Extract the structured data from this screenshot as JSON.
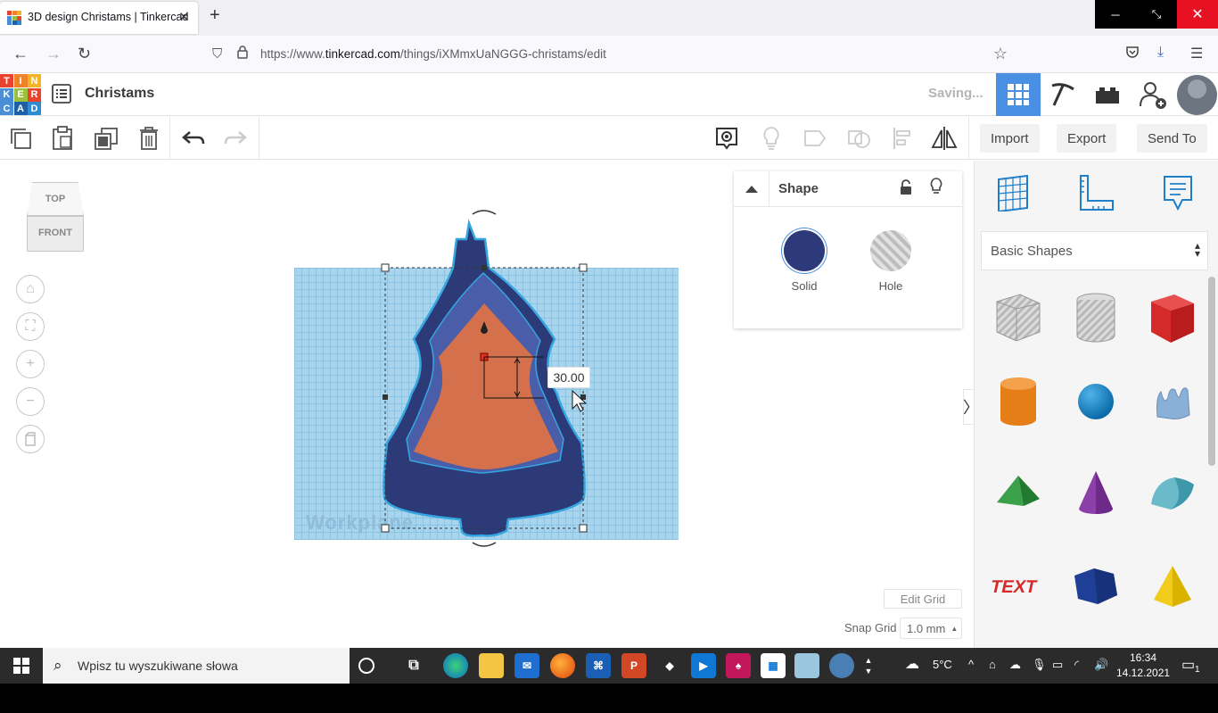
{
  "browser": {
    "tab_title": "3D design Christams | Tinkercad",
    "tab_close": "✕",
    "new_tab": "+",
    "url_prefix": "https://www.",
    "url_domain": "tinkercad.com",
    "url_path": "/things/iXMmxUaNGGG-christams/edit",
    "window_controls": {
      "minimize": "─",
      "maximize": "⤡",
      "close": "✕"
    }
  },
  "app": {
    "logo_letters": [
      "T",
      "I",
      "N",
      "K",
      "E",
      "R",
      "C",
      "A",
      "D"
    ],
    "logo_colors": [
      "#e8432e",
      "#f0822a",
      "#f4b427",
      "#4a8fd6",
      "#9bc03c",
      "#e8432e",
      "#4a8fd6",
      "#1d5fa8",
      "#2d8bd3"
    ],
    "project_name": "Christams",
    "status": "Saving...",
    "accent_color": "#4a90e2"
  },
  "toolbar": {
    "import_label": "Import",
    "export_label": "Export",
    "send_to_label": "Send To"
  },
  "viewcube": {
    "top": "TOP",
    "front": "FRONT"
  },
  "workplane": {
    "watermark": "Workplane",
    "dimension_value": "30.00"
  },
  "grid": {
    "edit_label": "Edit Grid",
    "snap_label": "Snap Grid",
    "snap_value": "1.0 mm"
  },
  "inspector": {
    "title": "Shape",
    "solid_label": "Solid",
    "hole_label": "Hole",
    "solid_color": "#2d3a7a"
  },
  "library": {
    "selected": "Basic Shapes",
    "shapes": [
      "Box",
      "Cylinder hole",
      "Box",
      "Cylinder",
      "Sphere",
      "Scribble",
      "Roof",
      "Cone",
      "Round Roof",
      "Text",
      "Polygon",
      "Pyramid"
    ]
  },
  "taskbar": {
    "search_placeholder": "Wpisz tu wyszukiwane słowa",
    "temperature": "5°C",
    "time": "16:34",
    "date": "14.12.2021",
    "notifications": "1"
  }
}
